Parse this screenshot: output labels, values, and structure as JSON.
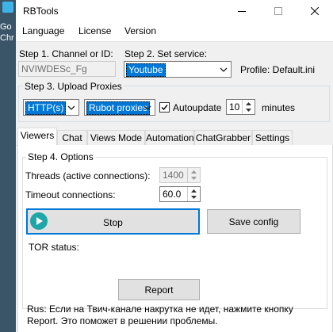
{
  "desktop": {
    "lines": [
      "Go",
      "Chr"
    ]
  },
  "window": {
    "title": "RBTools"
  },
  "menu": {
    "items": [
      "Language",
      "License",
      "Version"
    ]
  },
  "step1": {
    "label": "Step 1. Channel or ID:",
    "value": "NVIWDESc_Fg"
  },
  "step2": {
    "label": "Step 2. Set service:",
    "value": "Youtube",
    "profile": "Profile: Default.ini"
  },
  "step3": {
    "label": "Step 3. Upload Proxies",
    "proxy_type": "HTTP(s)",
    "proxy_source": "Rubot proxies",
    "autoupdate_label": "Autoupdate",
    "autoupdate_checked": true,
    "interval": "10",
    "interval_unit": "minutes"
  },
  "tabs": [
    "Viewers",
    "Chat",
    "Views Mode",
    "Automation",
    "ChatGrabber",
    "Settings"
  ],
  "active_tab": "Viewers",
  "step4": {
    "label": "Step 4. Options",
    "threads_label": "Threads (active connections):",
    "threads_value": "1400",
    "timeout_label": "Timeout connections:",
    "timeout_value": "60.0",
    "stop_label": "Stop",
    "save_label": "Save config",
    "tor_label": "TOR status:",
    "report_label": "Report",
    "notice": "Rus: Если на Твич-канале накрутка не идет, нажмите кнопку Report. Это поможет в решении проблемы."
  },
  "colors": {
    "accent": "#0078d7",
    "play": "#1ea6a8",
    "desktop": "#3a5568"
  }
}
